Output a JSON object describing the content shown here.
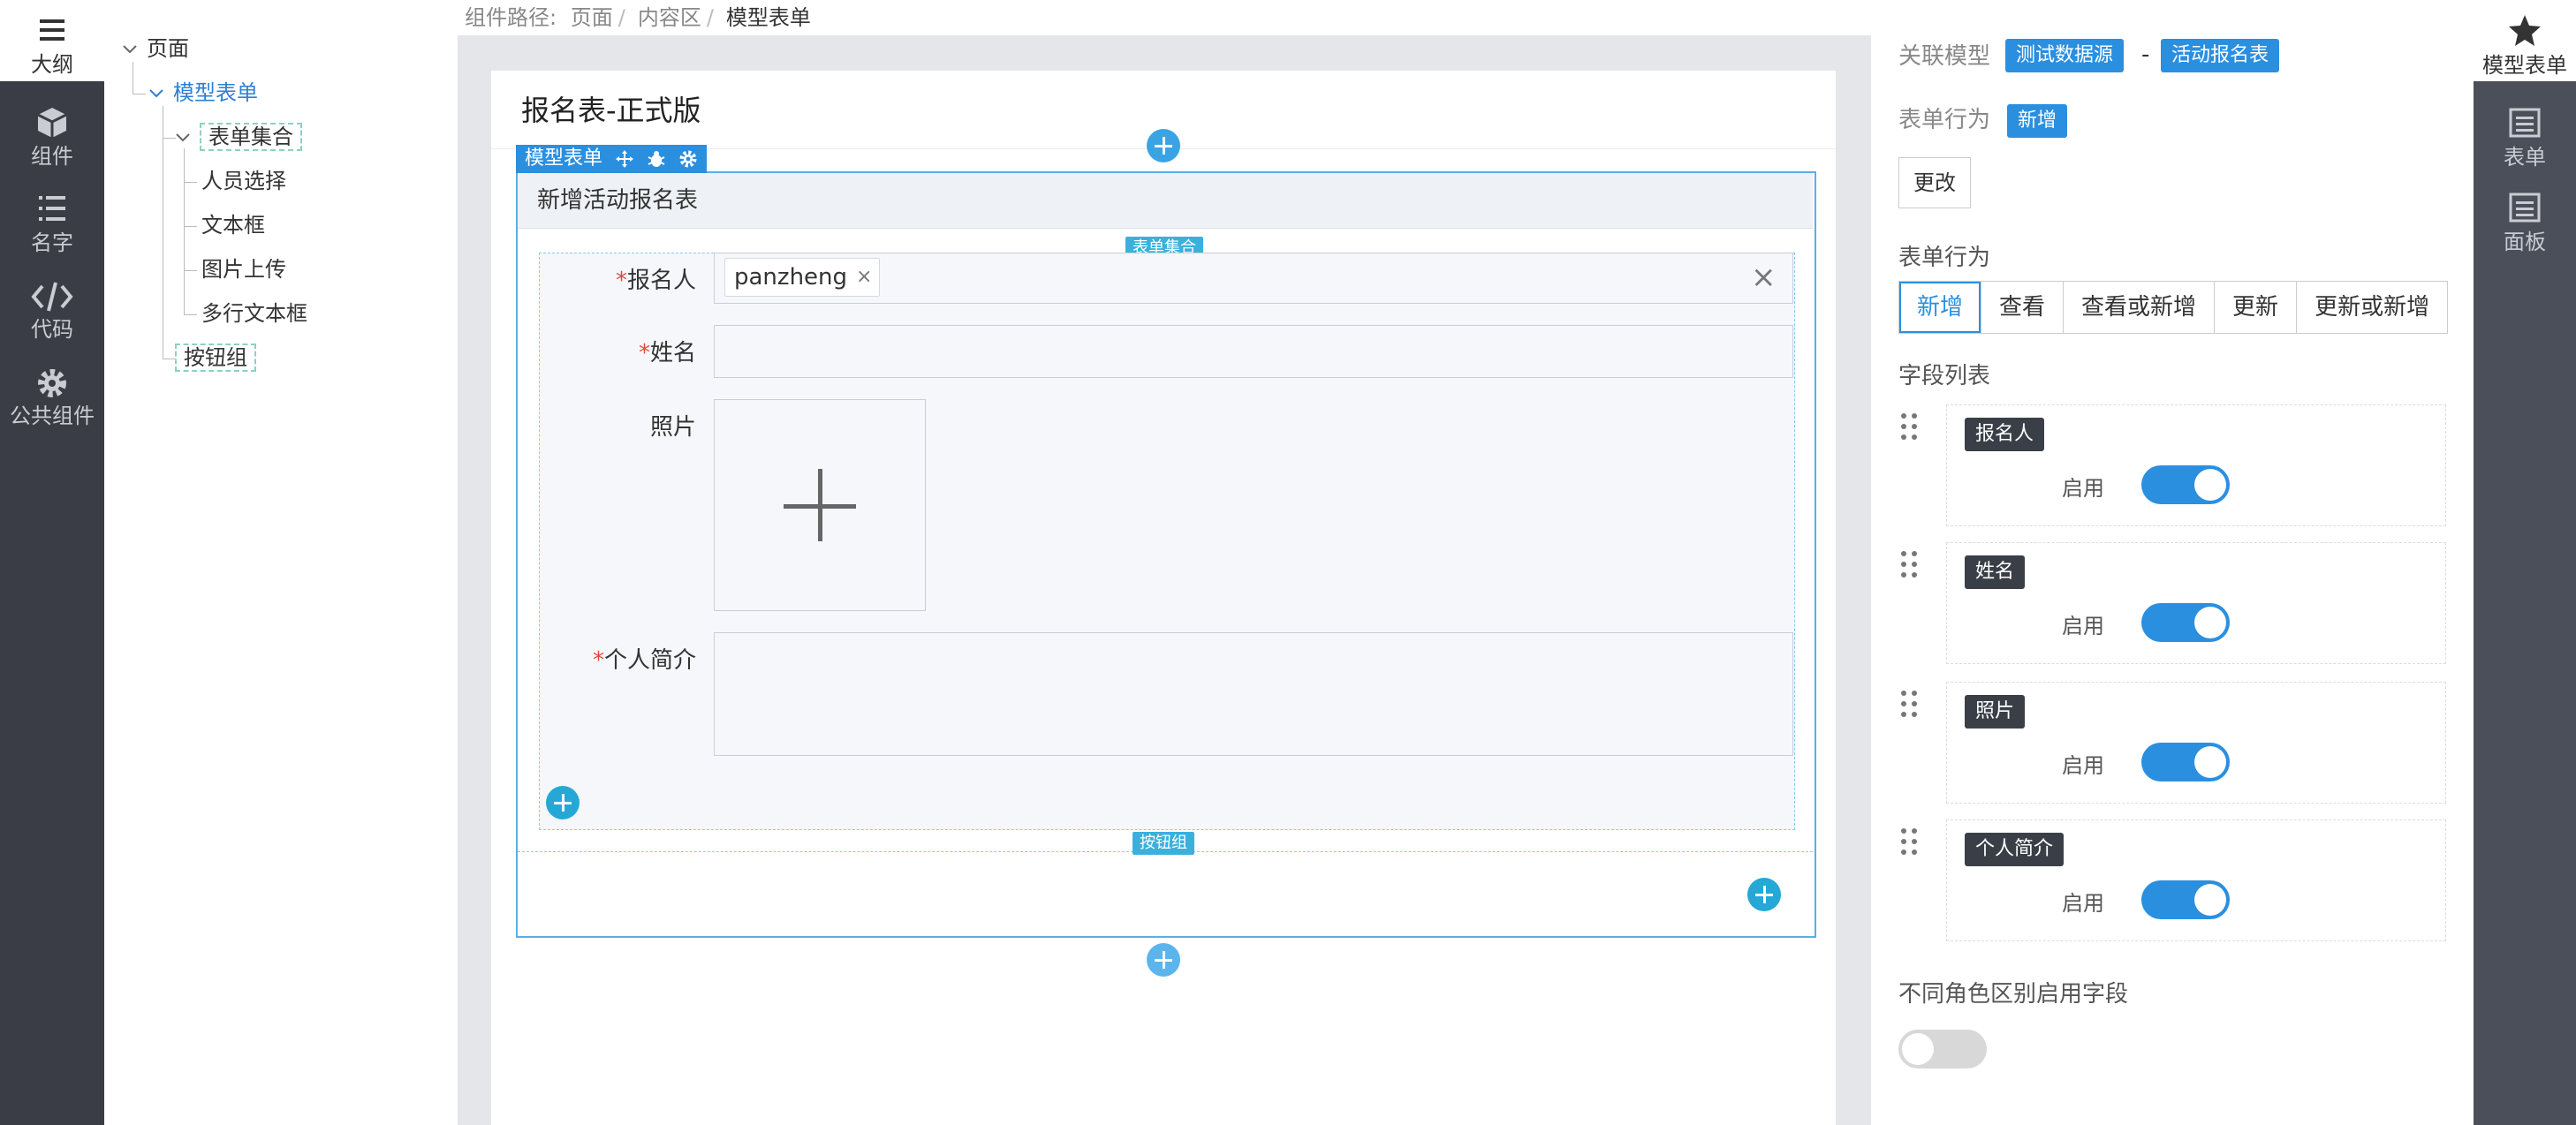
{
  "left_rail": {
    "items": [
      {
        "icon": "menu-icon",
        "label": "大纲"
      },
      {
        "icon": "cube-icon",
        "label": "组件"
      },
      {
        "icon": "list-icon",
        "label": "名字"
      },
      {
        "icon": "code-icon",
        "label": "代码"
      },
      {
        "icon": "gear-icon",
        "label": "公共组件"
      }
    ]
  },
  "tree": {
    "nodes": [
      {
        "label": "页面"
      },
      {
        "label": "模型表单"
      },
      {
        "label": "表单集合"
      },
      {
        "label": "人员选择"
      },
      {
        "label": "文本框"
      },
      {
        "label": "图片上传"
      },
      {
        "label": "多行文本框"
      },
      {
        "label": "按钮组"
      }
    ]
  },
  "breadcrumb": {
    "prefix": "组件路径:",
    "items": [
      "页面",
      "内容区",
      "模型表单"
    ],
    "separator": "/"
  },
  "page": {
    "title": "报名表-正式版",
    "model_form_tag": "模型表单",
    "form_header": "新增活动报名表",
    "form_set_tag": "表单集合",
    "button_group_tag": "按钮组",
    "fields": {
      "applicant": {
        "label": "报名人",
        "required_mark": "*",
        "chip": "panzheng",
        "chip_remove": "×",
        "clear": "×"
      },
      "name": {
        "label": "姓名",
        "required_mark": "*"
      },
      "photo": {
        "label": "照片"
      },
      "bio": {
        "label": "个人简介",
        "required_mark": "*"
      }
    }
  },
  "props": {
    "model_label": "关联模型",
    "model_source": "测试数据源",
    "model_dash": "-",
    "model_name": "活动报名表",
    "behavior_label": "表单行为",
    "behavior_value": "新增",
    "change_button": "更改",
    "behavior_section": "表单行为",
    "behavior_options": [
      "新增",
      "查看",
      "查看或新增",
      "更新",
      "更新或新增"
    ],
    "behavior_selected": "新增",
    "field_list_title": "字段列表",
    "fields": [
      {
        "name": "报名人",
        "enable_label": "启用",
        "enabled": true
      },
      {
        "name": "姓名",
        "enable_label": "启用",
        "enabled": true
      },
      {
        "name": "照片",
        "enable_label": "启用",
        "enabled": true
      },
      {
        "name": "个人简介",
        "enable_label": "启用",
        "enabled": true
      }
    ],
    "role_fields_label": "不同角色区别启用字段",
    "role_fields_enabled": false
  },
  "right_rail": {
    "items": [
      {
        "icon": "star-icon",
        "label": "模型表单"
      },
      {
        "icon": "form-icon",
        "label": "表单"
      },
      {
        "icon": "panel-icon",
        "label": "面板"
      }
    ]
  },
  "colors": {
    "accent": "#2b8fe0",
    "rail": "#3a3d45",
    "canvas": "#e4e6e9",
    "required": "#e0493f"
  }
}
